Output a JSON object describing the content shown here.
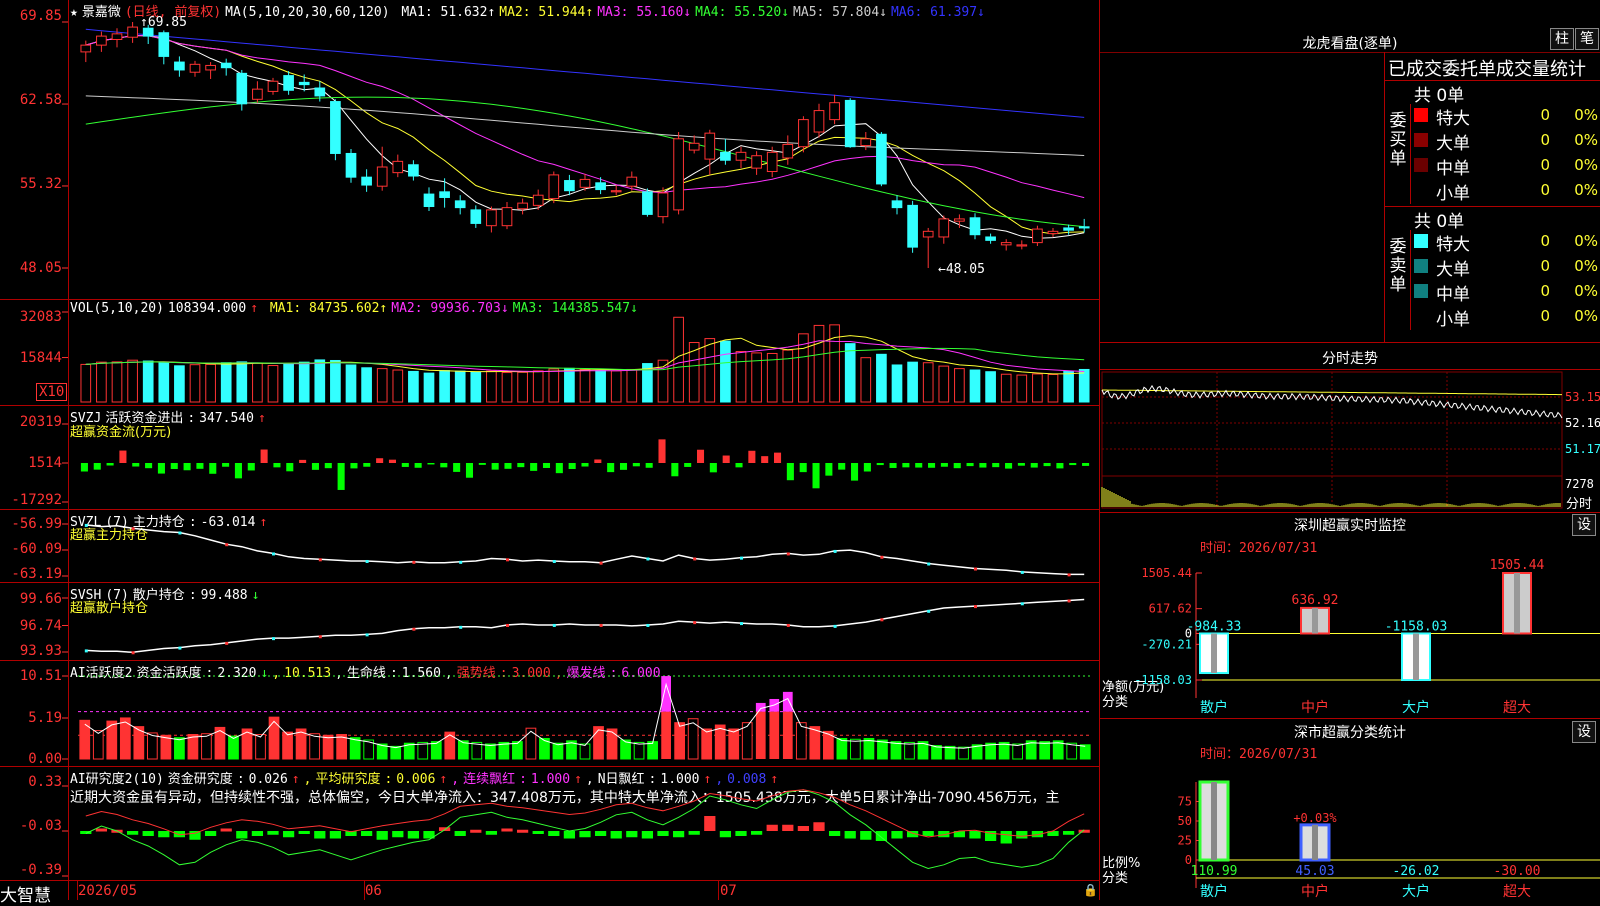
{
  "chart_data": [
    {
      "type": "candlestick",
      "stock_name": "景嘉微",
      "period": "(日线, 前复权)",
      "y_axis": [
        "69.85",
        "62.58",
        "55.32",
        "48.05"
      ],
      "high_label": "69.85",
      "low_label": "←48.05",
      "ylim": [
        48.05,
        69.85
      ],
      "ma_params": "MA(5,10,20,30,60,120)",
      "ma": [
        {
          "name": "MA1",
          "value": "51.632",
          "dir": "↑",
          "color": "#ffffff"
        },
        {
          "name": "MA2",
          "value": "51.944",
          "dir": "↑",
          "color": "#ffff33"
        },
        {
          "name": "MA3",
          "value": "55.160",
          "dir": "↓",
          "color": "#ff33ff"
        },
        {
          "name": "MA4",
          "value": "55.520",
          "dir": "↓",
          "color": "#33ff33"
        },
        {
          "name": "MA5",
          "value": "57.804",
          "dir": "↓",
          "color": "#cccccc"
        },
        {
          "name": "MA6",
          "value": "61.397",
          "dir": "↓",
          "color": "#3333ff"
        }
      ],
      "candles": [
        [
          67.2,
          67.8,
          66.3,
          68.2
        ],
        [
          67.8,
          68.6,
          67.2,
          69.0
        ],
        [
          68.3,
          68.8,
          67.6,
          69.3
        ],
        [
          68.5,
          69.4,
          68.0,
          69.85
        ],
        [
          69.3,
          68.6,
          67.9,
          69.6
        ],
        [
          68.9,
          66.8,
          66.1,
          69.1
        ],
        [
          66.3,
          65.6,
          65.0,
          66.8
        ],
        [
          65.4,
          66.1,
          65.0,
          66.4
        ],
        [
          65.6,
          66.0,
          64.8,
          66.3
        ],
        [
          66.2,
          65.8,
          65.1,
          66.6
        ],
        [
          65.3,
          62.6,
          62.0,
          65.6
        ],
        [
          63.0,
          63.9,
          62.7,
          64.6
        ],
        [
          63.7,
          64.6,
          63.4,
          64.9
        ],
        [
          65.1,
          63.8,
          63.4,
          65.5
        ],
        [
          64.5,
          64.3,
          63.7,
          65.2
        ],
        [
          64.0,
          63.3,
          62.8,
          64.6
        ],
        [
          62.8,
          58.2,
          57.6,
          63.0
        ],
        [
          58.2,
          56.1,
          55.6,
          58.6
        ],
        [
          56.1,
          55.4,
          54.8,
          56.8
        ],
        [
          55.3,
          57.0,
          54.9,
          58.8
        ],
        [
          56.5,
          57.5,
          56.1,
          58.1
        ],
        [
          57.2,
          56.2,
          55.8,
          57.6
        ],
        [
          54.6,
          53.5,
          53.1,
          55.2
        ],
        [
          54.8,
          54.3,
          53.4,
          56.0
        ],
        [
          54.0,
          53.4,
          52.8,
          54.5
        ],
        [
          53.2,
          52.0,
          51.6,
          53.6
        ],
        [
          51.8,
          53.2,
          51.2,
          53.5
        ],
        [
          51.8,
          53.4,
          51.5,
          53.9
        ],
        [
          53.3,
          53.8,
          52.8,
          54.2
        ],
        [
          53.6,
          54.5,
          53.2,
          55.0
        ],
        [
          54.2,
          56.3,
          53.8,
          56.6
        ],
        [
          55.8,
          54.9,
          54.5,
          56.3
        ],
        [
          55.2,
          55.9,
          54.9,
          56.4
        ],
        [
          55.6,
          55.0,
          54.6,
          56.1
        ],
        [
          54.8,
          54.9,
          54.5,
          55.4
        ],
        [
          55.3,
          56.1,
          54.9,
          56.6
        ],
        [
          54.8,
          52.8,
          52.6,
          55.1
        ],
        [
          52.6,
          54.7,
          52.0,
          55.2
        ],
        [
          53.2,
          59.5,
          52.8,
          60.1
        ],
        [
          58.5,
          59.1,
          58.2,
          59.8
        ],
        [
          57.7,
          60.0,
          56.3,
          60.3
        ],
        [
          58.3,
          57.6,
          57.2,
          59.5
        ],
        [
          57.6,
          58.3,
          56.9,
          58.8
        ],
        [
          56.9,
          58.0,
          56.3,
          58.4
        ],
        [
          56.6,
          58.3,
          56.1,
          58.8
        ],
        [
          57.8,
          59.0,
          57.2,
          59.8
        ],
        [
          58.8,
          61.2,
          58.3,
          61.5
        ],
        [
          60.1,
          62.0,
          59.6,
          62.6
        ],
        [
          61.2,
          62.7,
          60.8,
          63.4
        ],
        [
          62.9,
          58.8,
          58.7,
          63.1
        ],
        [
          58.9,
          59.5,
          58.5,
          60.1
        ],
        [
          59.9,
          55.5,
          55.3,
          60.1
        ],
        [
          54.0,
          53.4,
          52.8,
          54.5
        ],
        [
          53.6,
          49.9,
          49.4,
          54.0
        ],
        [
          50.8,
          51.3,
          48.05,
          51.6
        ],
        [
          50.8,
          52.4,
          50.2,
          52.7
        ],
        [
          52.2,
          52.4,
          51.6,
          52.8
        ],
        [
          52.5,
          51.0,
          50.6,
          52.9
        ],
        [
          50.8,
          50.5,
          50.2,
          51.1
        ],
        [
          50.1,
          50.3,
          49.6,
          50.6
        ],
        [
          50.0,
          50.1,
          49.7,
          50.5
        ],
        [
          50.3,
          51.5,
          50.0,
          51.8
        ],
        [
          51.1,
          51.3,
          50.8,
          51.6
        ],
        [
          51.6,
          51.4,
          51.0,
          51.9
        ],
        [
          51.7,
          51.6,
          51.2,
          52.4
        ]
      ]
    },
    {
      "type": "volume",
      "label": "VOL(5,10,20)",
      "value": "108394.000",
      "value_dir": "↑",
      "ma": [
        {
          "name": "MA1",
          "value": "84735.602",
          "dir": "↑",
          "color": "#ffff33"
        },
        {
          "name": "MA2",
          "value": "99936.703",
          "dir": "↓",
          "color": "#ff33ff"
        },
        {
          "name": "MA3",
          "value": "144385.547",
          "dir": "↓",
          "color": "#33ff33"
        }
      ],
      "y_axis": [
        "32083",
        "15844"
      ],
      "unit": "X10",
      "ylim": [
        0,
        32083
      ],
      "values": [
        13400,
        14200,
        14300,
        14900,
        14600,
        13900,
        12900,
        13300,
        13400,
        14000,
        14300,
        13900,
        13000,
        13700,
        14200,
        15000,
        14800,
        13200,
        12200,
        11900,
        11400,
        10900,
        10300,
        11200,
        11000,
        10700,
        11000,
        10500,
        10600,
        11100,
        11800,
        12000,
        11600,
        11300,
        11100,
        11600,
        13700,
        14900,
        30200,
        21200,
        22600,
        21700,
        18000,
        17500,
        17300,
        18500,
        24300,
        27300,
        27500,
        20800,
        15800,
        17000,
        13200,
        14200,
        14000,
        12800,
        11900,
        11400,
        10800,
        9900,
        9600,
        10000,
        9800,
        10900,
        11600
      ]
    },
    {
      "type": "bar",
      "label": "SVZJ",
      "title": "活跃资金进出",
      "value": "347.540",
      "value_dir": "↑",
      "subtitle": "超赢资金流(万元)",
      "y_axis": [
        "20319",
        "1514",
        "-17292"
      ],
      "ylim": [
        -17292,
        20319
      ],
      "values": [
        -4100,
        -3200,
        -1200,
        6000,
        -1700,
        -2500,
        -5100,
        -2900,
        -3500,
        -2800,
        -5200,
        -1800,
        -7400,
        -3600,
        6500,
        -2100,
        -4000,
        1500,
        -3300,
        -2500,
        -13000,
        -2600,
        -1800,
        2300,
        1600,
        -1900,
        -2300,
        -700,
        -2100,
        -4300,
        -7100,
        -900,
        -3200,
        -2800,
        -2000,
        -3800,
        -2400,
        -4900,
        -2900,
        -1700,
        1700,
        -4400,
        -3300,
        -1600,
        -2300,
        11400,
        -6400,
        -1900,
        6400,
        -4500,
        3600,
        -2100,
        5900,
        3300,
        5000,
        -8300,
        -4400,
        -12200,
        -6100,
        -3200,
        -8500,
        -4100,
        -1000,
        -2400,
        -2100,
        -2200,
        -2300,
        -1800,
        -2500,
        -1500,
        -2200,
        -2000,
        -2700,
        -1300,
        -2200,
        -1500,
        -2600,
        -1000,
        -1400
      ]
    },
    {
      "type": "line",
      "label": "SVZL",
      "window": "(7)",
      "title": "主力持仓",
      "value": "-63.014",
      "value_dir": "↑",
      "subtitle": "超赢主力持仓",
      "y_axis": [
        "-56.99",
        "-60.09",
        "-63.19"
      ],
      "ylim": [
        -63.19,
        -56.99
      ],
      "values": [
        -57.1,
        -57.3,
        -57.2,
        -57.5,
        -57.7,
        -57.9,
        -58.0,
        -58.4,
        -58.9,
        -59.4,
        -59.7,
        -60.2,
        -60.5,
        -60.9,
        -61.1,
        -61.2,
        -61.3,
        -61.4,
        -61.4,
        -61.5,
        -61.6,
        -61.5,
        -61.6,
        -61.6,
        -61.5,
        -61.4,
        -61.1,
        -61.2,
        -61.4,
        -61.3,
        -61.4,
        -61.5,
        -61.5,
        -61.6,
        -61.2,
        -60.8,
        -61.1,
        -61.4,
        -60.7,
        -61.1,
        -61.3,
        -61.2,
        -61.0,
        -60.9,
        -60.6,
        -60.5,
        -60.7,
        -60.6,
        -60.2,
        -60.1,
        -60.4,
        -60.9,
        -61.1,
        -61.4,
        -61.7,
        -61.9,
        -62.1,
        -62.3,
        -62.4,
        -62.5,
        -62.7,
        -62.8,
        -62.9,
        -63.0,
        -63.0
      ]
    },
    {
      "type": "line",
      "label": "SVSH",
      "window": "(7)",
      "title": "散户持仓",
      "value": "99.488",
      "value_dir": "↓",
      "subtitle": "超赢散户持仓",
      "y_axis": [
        "99.66",
        "96.74",
        "93.93"
      ],
      "ylim": [
        93.93,
        99.66
      ],
      "values": [
        94.1,
        94.0,
        94.0,
        93.9,
        94.1,
        94.3,
        94.4,
        94.6,
        94.7,
        94.9,
        95.1,
        95.3,
        95.4,
        95.4,
        95.5,
        95.6,
        95.7,
        95.7,
        95.8,
        95.9,
        96.2,
        96.4,
        96.5,
        96.5,
        96.6,
        96.6,
        96.5,
        96.8,
        96.9,
        96.8,
        96.8,
        96.9,
        96.8,
        96.8,
        96.8,
        96.7,
        96.8,
        96.9,
        97.2,
        97.1,
        97.0,
        97.1,
        97.0,
        96.9,
        96.9,
        96.8,
        96.6,
        96.6,
        96.7,
        96.9,
        97.1,
        97.4,
        97.7,
        98.0,
        98.3,
        98.6,
        98.7,
        98.8,
        98.9,
        99.0,
        99.1,
        99.2,
        99.3,
        99.4,
        99.5
      ]
    },
    {
      "type": "bar",
      "label": "AI活跃度2",
      "title": "资金活跃度",
      "value": "2.320",
      "value_dir": "↓",
      "value2": "10.513",
      "life_line_label": "生命线",
      "life_line": "1.560",
      "strong_line_label": "强势线",
      "strong_line": "3.000",
      "burst_line_label": "爆发线",
      "burst_line": "6.000",
      "y_axis": [
        "10.51",
        "5.19",
        "0.00"
      ],
      "ylim": [
        0,
        10.51
      ],
      "values": [
        4.9,
        3.6,
        4.8,
        5.2,
        4.1,
        3.3,
        3.0,
        2.7,
        3.1,
        3.2,
        4.0,
        2.9,
        3.8,
        3.1,
        5.3,
        3.4,
        3.8,
        3.2,
        3.0,
        3.1,
        2.7,
        2.4,
        1.9,
        1.6,
        2.0,
        2.1,
        2.2,
        3.4,
        2.3,
        2.1,
        1.9,
        2.1,
        2.2,
        3.9,
        2.6,
        2.0,
        2.3,
        1.9,
        4.1,
        3.8,
        2.4,
        2.1,
        2.2,
        10.5,
        4.6,
        5.1,
        3.8,
        4.3,
        3.8,
        4.6,
        7.1,
        7.6,
        8.5,
        4.6,
        4.1,
        3.5,
        2.6,
        2.5,
        2.6,
        2.4,
        2.2,
        2.1,
        2.2,
        1.7,
        1.6,
        1.5,
        1.8,
        2.0,
        2.1,
        1.9,
        2.3,
        2.2,
        2.3,
        2.0,
        1.8
      ]
    },
    {
      "type": "bar",
      "label": "AI研究度2(10)",
      "title": "资金研究度",
      "value": "0.026",
      "value_dir": "↑",
      "avg_label": "平均研究度",
      "avg": "0.006",
      "avg_dir": "↑",
      "red_label": "连续飘红",
      "red": "1.000",
      "red_dir": "↑",
      "nred_label": "N日飘红",
      "nred": "1.000",
      "nred_dir": "↑",
      "last": "0.008",
      "last_dir": "↑",
      "y_axis": [
        "0.33",
        "-0.03",
        "-0.39"
      ],
      "ylim": [
        -0.39,
        0.33
      ],
      "values": [
        -0.01,
        0.02,
        0.01,
        -0.03,
        -0.04,
        -0.05,
        -0.05,
        -0.07,
        -0.04,
        0.02,
        -0.06,
        -0.04,
        -0.03,
        -0.05,
        -0.02,
        -0.06,
        -0.06,
        -0.04,
        -0.04,
        -0.07,
        -0.05,
        -0.06,
        -0.06,
        0.03,
        -0.04,
        0.01,
        -0.03,
        0.02,
        0.01,
        -0.02,
        -0.04,
        -0.06,
        -0.05,
        -0.04,
        -0.06,
        -0.05,
        -0.06,
        -0.04,
        -0.05,
        -0.03,
        0.12,
        -0.05,
        -0.04,
        -0.03,
        0.05,
        0.05,
        0.04,
        0.07,
        -0.04,
        -0.06,
        -0.07,
        -0.08,
        -0.06,
        -0.05,
        -0.04,
        -0.05,
        -0.05,
        -0.06,
        -0.08,
        -0.1,
        -0.06,
        -0.05,
        -0.04,
        -0.03,
        0.01
      ],
      "signal": [
        -0.05,
        0.01,
        -0.03,
        -0.1,
        -0.15,
        -0.22,
        -0.3,
        -0.28,
        -0.2,
        -0.14,
        -0.1,
        -0.12,
        -0.16,
        -0.22,
        -0.2,
        -0.18,
        -0.22,
        -0.26,
        -0.22,
        -0.18,
        -0.15,
        -0.12,
        -0.1,
        -0.02,
        0.08,
        0.1,
        0.12,
        0.08,
        0.06,
        0.03,
        0.0,
        -0.03,
        -0.01,
        0.04,
        0.1,
        0.12,
        0.06,
        0.02,
        0.08,
        0.15,
        0.25,
        0.22,
        0.18,
        0.15,
        0.22,
        0.28,
        0.3,
        0.26,
        0.2,
        0.1,
        0.02,
        -0.08,
        -0.18,
        -0.28,
        -0.33,
        -0.3,
        -0.25,
        -0.24,
        -0.28,
        -0.3,
        -0.32,
        -0.3,
        -0.25,
        -0.12,
        -0.02
      ]
    }
  ],
  "commentary": "近期大资金虽有异动，但持续性不强，总体偏空，今日大单净流入：347.408万元，其中特大单净流入：1505.438万元，大单5日累计净出-7090.456万元，主",
  "x_axis": [
    "2026/05",
    "06",
    "07"
  ],
  "app_logo": "大智慧",
  "right_panel": {
    "lhb": {
      "title": "龙虎看盘(逐单)",
      "btn_bar": "柱",
      "btn_pen": "笔",
      "tab_title": "已成交委托单成交量统计",
      "buy": {
        "side_label": [
          "委",
          "买",
          "单"
        ],
        "count": "共 0单",
        "rows": [
          {
            "label": "特大",
            "value": "0",
            "pct": "0%",
            "color": "#ff0000"
          },
          {
            "label": "大单",
            "value": "0",
            "pct": "0%",
            "color": "#8a0000"
          },
          {
            "label": "中单",
            "value": "0",
            "pct": "0%",
            "color": "#6a0000"
          },
          {
            "label": "小单",
            "value": "0",
            "pct": "0%",
            "color": ""
          }
        ]
      },
      "sell": {
        "side_label": [
          "委",
          "卖",
          "单"
        ],
        "count": "共 0单",
        "rows": [
          {
            "label": "特大",
            "value": "0",
            "pct": "0%",
            "color": "#33ffff"
          },
          {
            "label": "大单",
            "value": "0",
            "pct": "0%",
            "color": "#108080"
          },
          {
            "label": "中单",
            "value": "0",
            "pct": "0%",
            "color": "#108080"
          },
          {
            "label": "小单",
            "value": "0",
            "pct": "0%",
            "color": ""
          }
        ]
      }
    },
    "intraday": {
      "title": "分时走势",
      "price_ticks": [
        "53.15",
        "52.16",
        "51.17"
      ],
      "vol_tick": "7278",
      "vol_label": "分时"
    },
    "monitor": {
      "title": "深圳超赢实时监控",
      "settings": "设",
      "time_label": "时间：2026/07/31",
      "ylim": [
        -1158.03,
        1505.44
      ],
      "y_axis": [
        "1505.44",
        "617.62",
        "0",
        "-270.21",
        "-1158.03"
      ],
      "y_label": "净额(万元)",
      "x_label": "分类",
      "categories": [
        "散户",
        "中户",
        "大户",
        "超大"
      ],
      "values": [
        -984.33,
        636.92,
        -1158.03,
        1505.44
      ],
      "value_labels": [
        "-984.33",
        "636.92",
        "-1158.03",
        "1505.44"
      ]
    },
    "stats": {
      "title": "深市超赢分类统计",
      "settings": "设",
      "time_label": "时间：2026/07/31",
      "y_axis": [
        "75",
        "50",
        "25",
        "0"
      ],
      "y_label": "比例%",
      "x_label": "分类",
      "categories": [
        "散户",
        "中户",
        "大户",
        "超大"
      ],
      "values": [
        110.99,
        45.03,
        -26.02,
        -30.0
      ],
      "value_labels": [
        "110.99",
        "45.03",
        "-26.02",
        "-30.00"
      ],
      "annotation": "+0.03%"
    }
  }
}
